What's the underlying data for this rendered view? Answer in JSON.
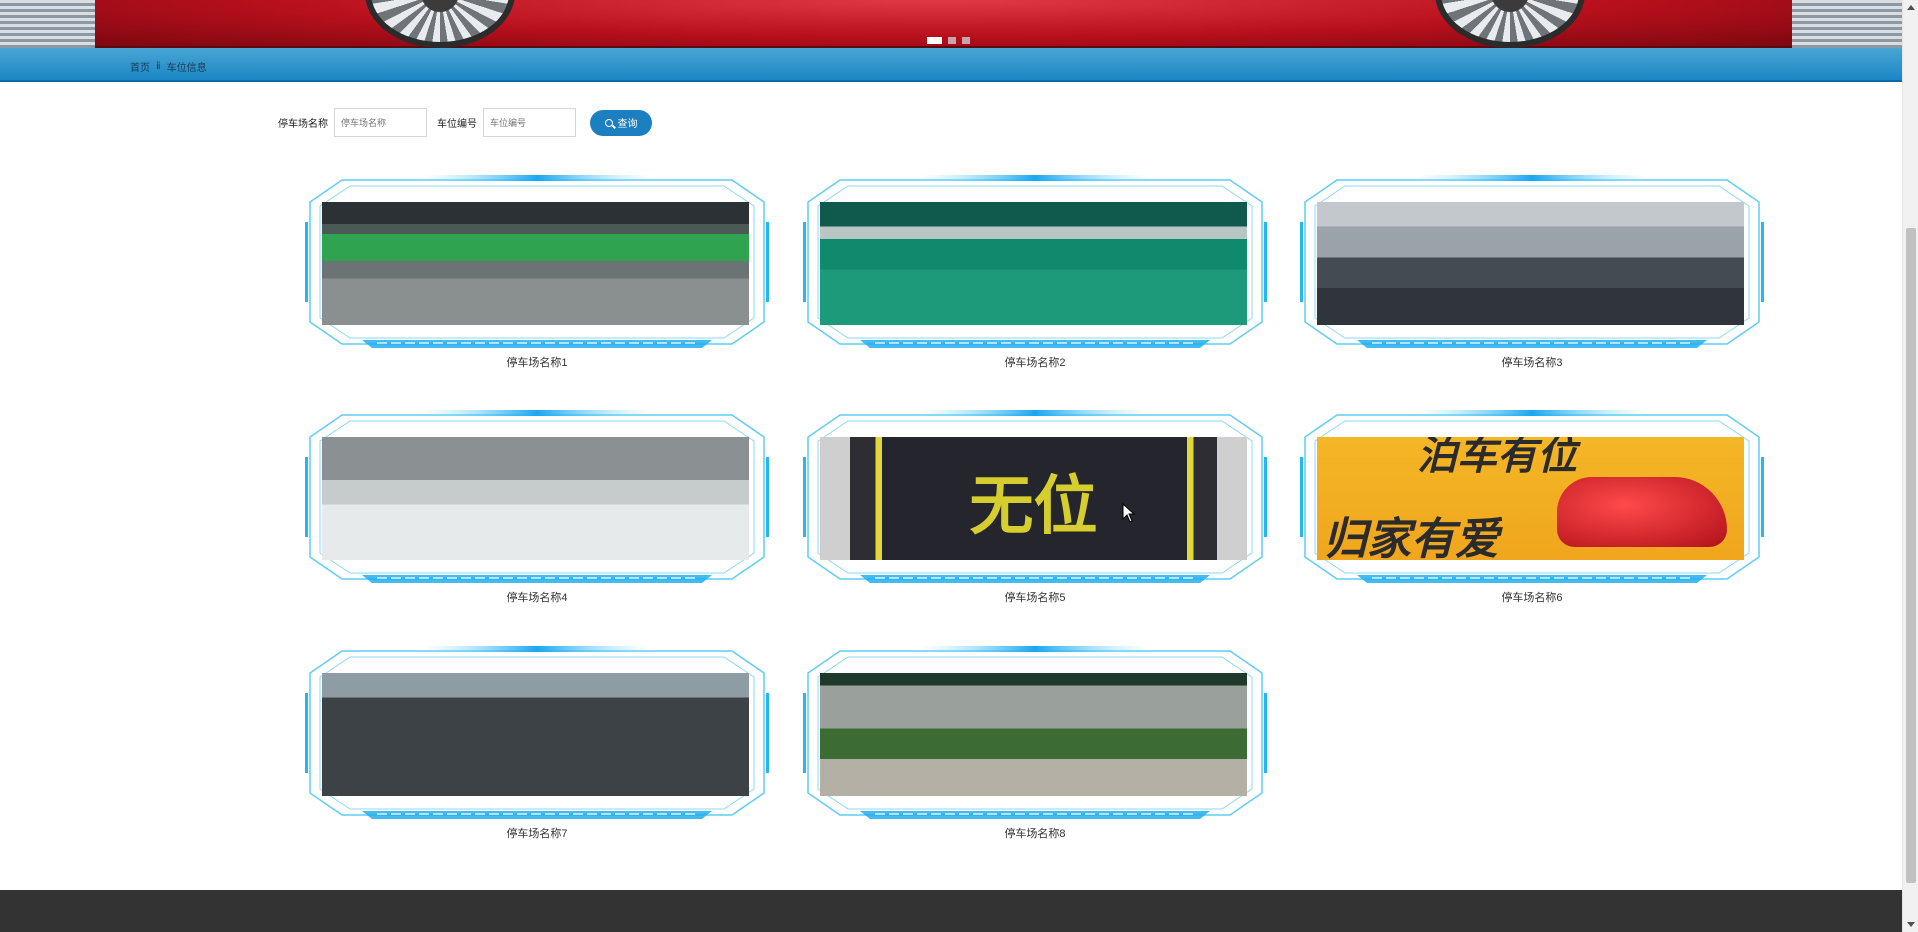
{
  "banner": {
    "dots": [
      true,
      false,
      false
    ]
  },
  "breadcrumb": {
    "home": "首页",
    "separator": "ⅱ",
    "current": "车位信息"
  },
  "search": {
    "field1_label": "停车场名称",
    "field1_placeholder": "停车场名称",
    "field2_label": "车位编号",
    "field2_placeholder": "车位编号",
    "button_label": "查询"
  },
  "cards": [
    {
      "label": "停车场名称1",
      "image": "underground-garage"
    },
    {
      "label": "停车场名称2",
      "image": "green-garage-b2"
    },
    {
      "label": "停车场名称3",
      "image": "garage-cars"
    },
    {
      "label": "停车场名称4",
      "image": "white-floor-garage"
    },
    {
      "label": "停车场名称5",
      "image": "no-spot-sign",
      "image_text": "无位"
    },
    {
      "label": "停车场名称6",
      "image": "red-car-poster",
      "image_text_top": "泊车有位",
      "image_text_bottom": "归家有爱"
    },
    {
      "label": "停车场名称7",
      "image": "outdoor-lot"
    },
    {
      "label": "停车场名称8",
      "image": "street-parking"
    }
  ],
  "colors": {
    "accent": "#1c7fc0",
    "bar": "#2a92cc",
    "frame": "#29b6f0",
    "footer": "#333333"
  }
}
